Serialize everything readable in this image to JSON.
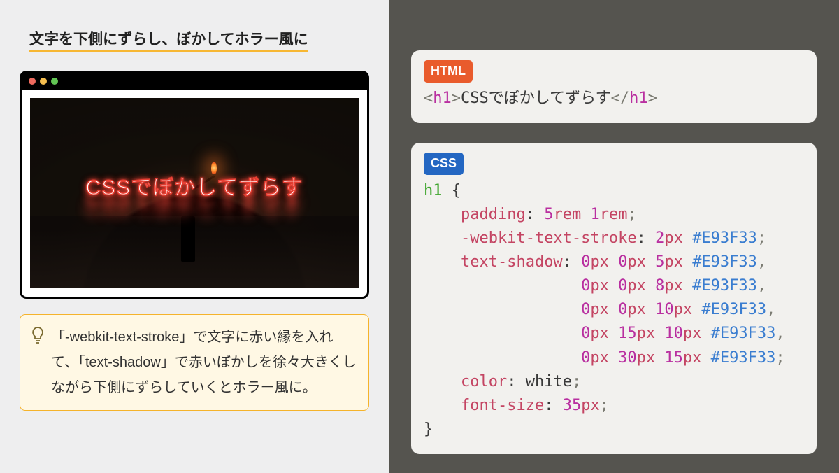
{
  "title": "文字を下側にずらし、ぼかしてホラー風に",
  "scene_text": "CSSでぼかしてずらす",
  "tip": {
    "text": "「-webkit-text-stroke」で文字に赤い縁を入れて、「text-shadow」で赤いぼかしを徐々大きくしながら下側にずらしていくとホラー風に。"
  },
  "html_panel": {
    "label": "HTML",
    "tag": "h1",
    "content": "CSSでぼかしてずらす"
  },
  "css_panel": {
    "label": "CSS",
    "selector": "h1",
    "rules": {
      "padding": {
        "v1": "5",
        "u1": "rem",
        "v2": "1",
        "u2": "rem"
      },
      "webkit_text_stroke": {
        "v": "2",
        "u": "px",
        "hex": "#E93F33"
      },
      "text_shadow": [
        {
          "x": "0",
          "xu": "px",
          "y": "0",
          "yu": "px",
          "b": "5",
          "bu": "px",
          "hex": "#E93F33"
        },
        {
          "x": "0",
          "xu": "px",
          "y": "0",
          "yu": "px",
          "b": "8",
          "bu": "px",
          "hex": "#E93F33"
        },
        {
          "x": "0",
          "xu": "px",
          "y": "0",
          "yu": "px",
          "b": "10",
          "bu": "px",
          "hex": "#E93F33"
        },
        {
          "x": "0",
          "xu": "px",
          "y": "15",
          "yu": "px",
          "b": "10",
          "bu": "px",
          "hex": "#E93F33"
        },
        {
          "x": "0",
          "xu": "px",
          "y": "30",
          "yu": "px",
          "b": "15",
          "bu": "px",
          "hex": "#E93F33"
        }
      ],
      "color": "white",
      "font_size": {
        "v": "35",
        "u": "px"
      }
    }
  }
}
